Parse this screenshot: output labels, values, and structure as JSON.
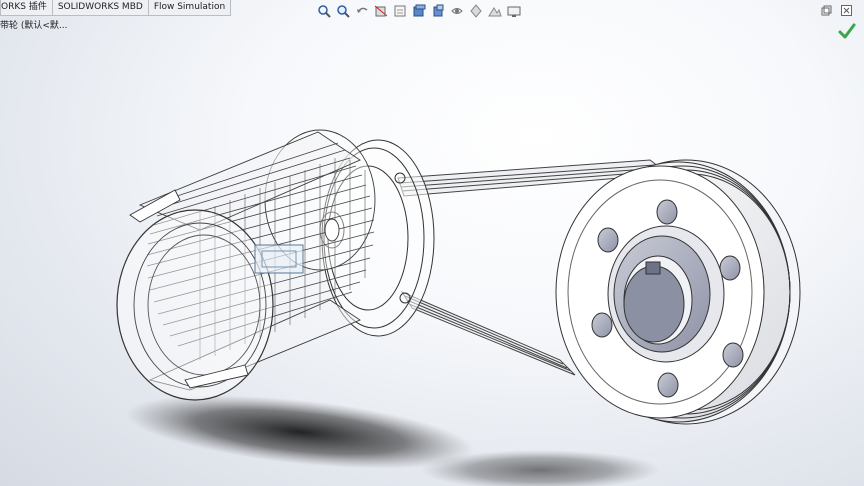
{
  "tabs": [
    {
      "label": "ORKS 插件"
    },
    {
      "label": "SOLIDWORKS MBD"
    },
    {
      "label": "Flow Simulation"
    }
  ],
  "tree_label": "带轮  (默认<默...",
  "headsup_icons": [
    "zoom-to-fit-icon",
    "zoom-area-icon",
    "previous-view-icon",
    "section-view-icon",
    "dynamic-annotation-icon",
    "view-orientation-icon",
    "display-style-icon",
    "hide-show-icon",
    "edit-appearance-icon",
    "apply-scene-icon",
    "view-settings-icon"
  ],
  "window_controls": [
    "restore-icon",
    "close-icon"
  ],
  "colors": {
    "accent_check": "#3aa54a",
    "background": "#eef1f5"
  }
}
